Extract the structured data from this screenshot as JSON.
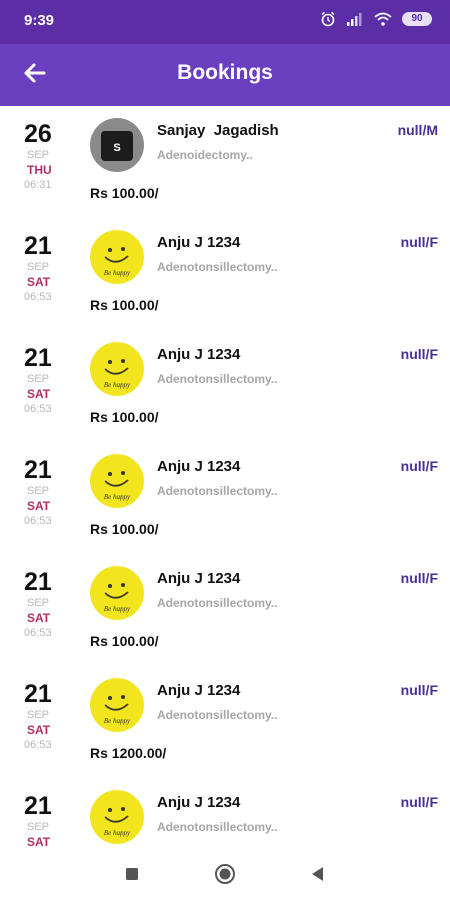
{
  "status": {
    "time": "9:39",
    "battery": "90"
  },
  "header": {
    "title": "Bookings"
  },
  "bookings": [
    {
      "day": "26",
      "month": "SEP",
      "weekday": "THU",
      "time": "06:31",
      "name": "Sanjay  Jagadish",
      "procedure": "Adenoidectomy..",
      "tag": "null/M",
      "price": "Rs 100.00/",
      "avatar": "letter",
      "avatar_letter": "S"
    },
    {
      "day": "21",
      "month": "SEP",
      "weekday": "SAT",
      "time": "06:53",
      "name": "Anju J 1234",
      "procedure": "Adenotonsillectomy..",
      "tag": "null/F",
      "price": "Rs 100.00/",
      "avatar": "smiley",
      "avatar_text": "Be happy"
    },
    {
      "day": "21",
      "month": "SEP",
      "weekday": "SAT",
      "time": "06:53",
      "name": "Anju J 1234",
      "procedure": "Adenotonsillectomy..",
      "tag": "null/F",
      "price": "Rs 100.00/",
      "avatar": "smiley",
      "avatar_text": "Be happy"
    },
    {
      "day": "21",
      "month": "SEP",
      "weekday": "SAT",
      "time": "06:53",
      "name": "Anju J 1234",
      "procedure": "Adenotonsillectomy..",
      "tag": "null/F",
      "price": "Rs 100.00/",
      "avatar": "smiley",
      "avatar_text": "Be happy"
    },
    {
      "day": "21",
      "month": "SEP",
      "weekday": "SAT",
      "time": "06:53",
      "name": "Anju J 1234",
      "procedure": "Adenotonsillectomy..",
      "tag": "null/F",
      "price": "Rs 100.00/",
      "avatar": "smiley",
      "avatar_text": "Be happy"
    },
    {
      "day": "21",
      "month": "SEP",
      "weekday": "SAT",
      "time": "06:53",
      "name": "Anju J 1234",
      "procedure": "Adenotonsillectomy..",
      "tag": "null/F",
      "price": "Rs 1200.00/",
      "avatar": "smiley",
      "avatar_text": "Be happy"
    },
    {
      "day": "21",
      "month": "SEP",
      "weekday": "SAT",
      "time": "",
      "name": "Anju J 1234",
      "procedure": "Adenotonsillectomy..",
      "tag": "null/F",
      "price": "",
      "avatar": "smiley",
      "avatar_text": "Be happy"
    }
  ],
  "icons": {
    "back": "arrow-left-icon",
    "alarm": "alarm-icon",
    "signal": "signal-icon",
    "wifi": "wifi-icon",
    "battery": "battery-icon",
    "nav_recents": "square-icon",
    "nav_home": "circle-icon",
    "nav_back": "triangle-back-icon"
  },
  "colors": {
    "status_bar": "#5b2ea6",
    "app_bar": "#6a3fc0",
    "weekday": "#b22d6a",
    "tag": "#4a2d96",
    "muted": "#a7a7a7"
  }
}
